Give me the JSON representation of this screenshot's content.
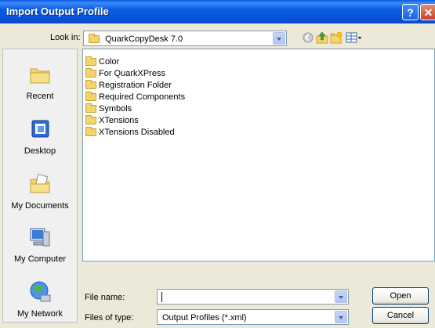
{
  "window": {
    "title": "Import Output Profile",
    "help_glyph": "?",
    "close_glyph": "✕"
  },
  "look_in": {
    "label": "Look in:",
    "value": "QuarkCopyDesk 7.0"
  },
  "toolbar": {
    "icons": [
      "back-icon",
      "up-folder-icon",
      "new-folder-icon",
      "view-menu-icon"
    ]
  },
  "places": [
    {
      "label": "Recent",
      "icon": "recent-icon"
    },
    {
      "label": "Desktop",
      "icon": "desktop-icon"
    },
    {
      "label": "My Documents",
      "icon": "my-documents-icon"
    },
    {
      "label": "My Computer",
      "icon": "my-computer-icon"
    },
    {
      "label": "My Network",
      "icon": "my-network-icon"
    }
  ],
  "files": [
    {
      "name": "Color"
    },
    {
      "name": "For QuarkXPress"
    },
    {
      "name": "Registration Folder"
    },
    {
      "name": "Required Components"
    },
    {
      "name": "Symbols"
    },
    {
      "name": "XTensions"
    },
    {
      "name": "XTensions Disabled"
    }
  ],
  "file_name": {
    "label": "File name:",
    "value": ""
  },
  "file_type": {
    "label": "Files of type:",
    "value": "Output Profiles (*.xml)"
  },
  "buttons": {
    "open": "Open",
    "cancel": "Cancel"
  }
}
